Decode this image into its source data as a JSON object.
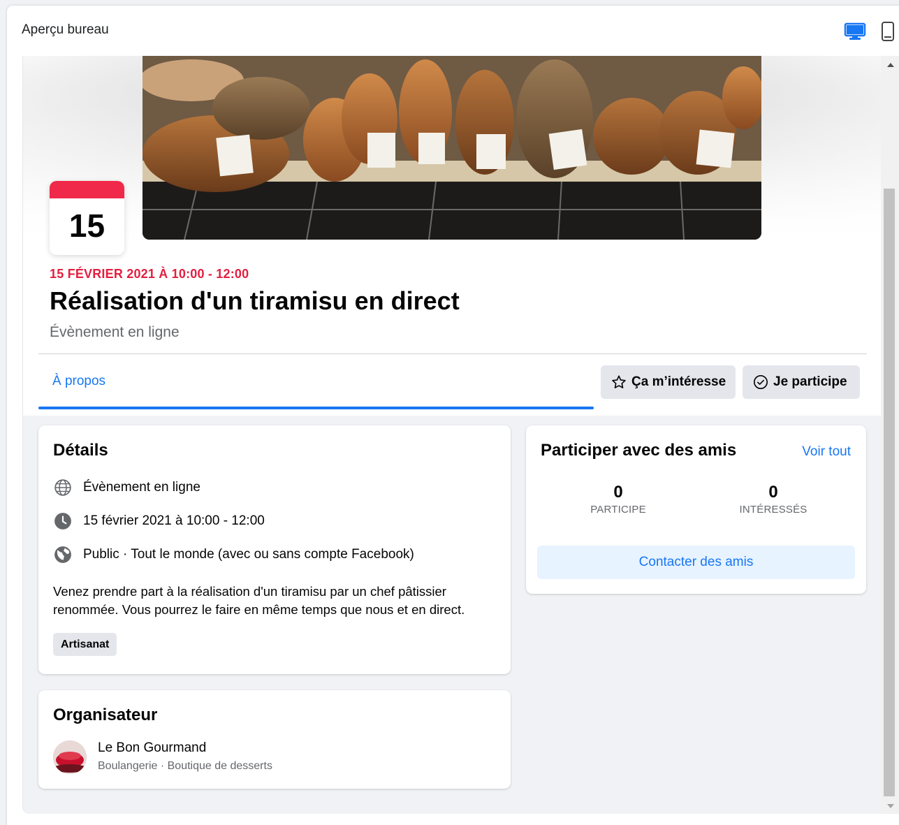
{
  "header": {
    "title": "Aperçu bureau",
    "desktop_icon": "desktop-icon",
    "mobile_icon": "mobile-icon"
  },
  "event": {
    "calendar_day": "15",
    "date_line": "15 FÉVRIER 2021 À 10:00 - 12:00",
    "title": "Réalisation d'un tiramisu en direct",
    "subtitle": "Évènement en ligne"
  },
  "tabs": {
    "about": "À propos"
  },
  "actions": {
    "interested": "Ça m’intéresse",
    "going": "Je participe"
  },
  "details": {
    "heading": "Détails",
    "location": "Évènement en ligne",
    "datetime": "15 février 2021 à 10:00 - 12:00",
    "privacy": "Public · Tout le monde (avec ou sans compte Facebook)",
    "description": "Venez prendre part à la réalisation d'un tiramisu par un chef pâtissier renommée. Vous pourrez le faire en même temps que nous et en direct.",
    "tag": "Artisanat"
  },
  "organizer": {
    "heading": "Organisateur",
    "name": "Le Bon Gourmand",
    "category": "Boulangerie · Boutique de desserts"
  },
  "friends": {
    "heading": "Participer avec des amis",
    "see_all": "Voir tout",
    "going_count": "0",
    "going_label": "PARTICIPE",
    "interested_count": "0",
    "interested_label": "INTÉRESSÉS",
    "contact_button": "Contacter des amis"
  },
  "colors": {
    "accent": "#1877f2",
    "date_red": "#e41e3f",
    "calendar_red": "#f02849",
    "background": "#f0f2f5"
  }
}
